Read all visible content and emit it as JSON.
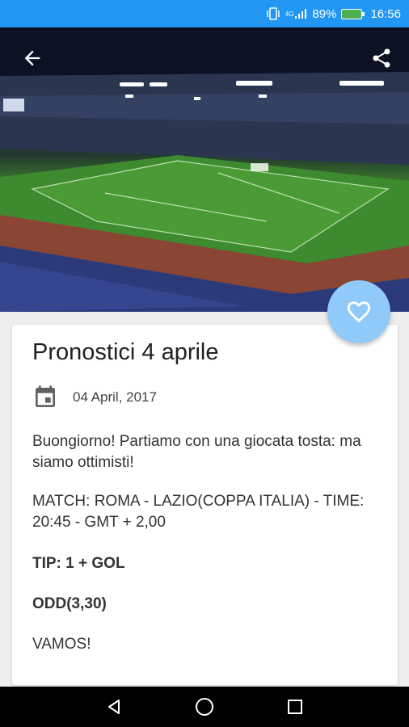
{
  "status_bar": {
    "signal_label": "4G",
    "battery_percent": "89%",
    "time": "16:56"
  },
  "toolbar": {
    "back_icon": "arrow-left-icon",
    "share_icon": "share-icon"
  },
  "fab": {
    "icon": "heart-outline-icon",
    "color": "#90caf9"
  },
  "post": {
    "title": "Pronostici 4 aprile",
    "date": "04 April, 2017",
    "paragraphs": [
      "Buongiorno! Partiamo con una giocata tosta: ma siamo ottimisti!",
      "MATCH: ROMA - LAZIO(COPPA ITALIA) - TIME: 20:45 - GMT + 2,00",
      "TIP: 1 + GOL",
      "ODD(3,30)",
      "VAMOS!"
    ]
  },
  "colors": {
    "accent": "#2196f3",
    "card": "#ffffff",
    "background": "#eeeeee"
  }
}
